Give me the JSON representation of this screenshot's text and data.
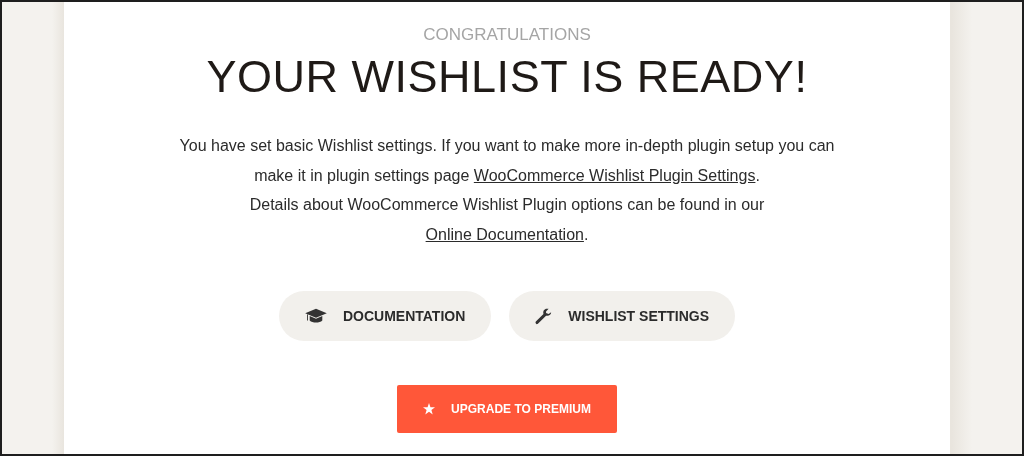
{
  "header": {
    "eyebrow": "CONGRATULATIONS",
    "title": "YOUR WISHLIST IS READY!"
  },
  "paragraphs": [
    {
      "parts": [
        {
          "kind": "text",
          "text": "You have set basic Wishlist settings. If you want to make more in-depth plugin setup you can make it in plugin settings page "
        },
        {
          "kind": "link",
          "text": "WooCommerce Wishlist Plugin Settings"
        },
        {
          "kind": "text",
          "text": "."
        }
      ]
    },
    {
      "parts": [
        {
          "kind": "text",
          "text": "Details about WooCommerce Wishlist Plugin options can be found in our "
        },
        {
          "kind": "link",
          "text": "Online Documentation"
        },
        {
          "kind": "text",
          "text": "."
        }
      ]
    }
  ],
  "buttons": [
    {
      "label": "DOCUMENTATION"
    },
    {
      "label": "WISHLIST SETTINGS"
    }
  ],
  "primary_button": {
    "label": "UPGRADE TO PREMIUM"
  }
}
